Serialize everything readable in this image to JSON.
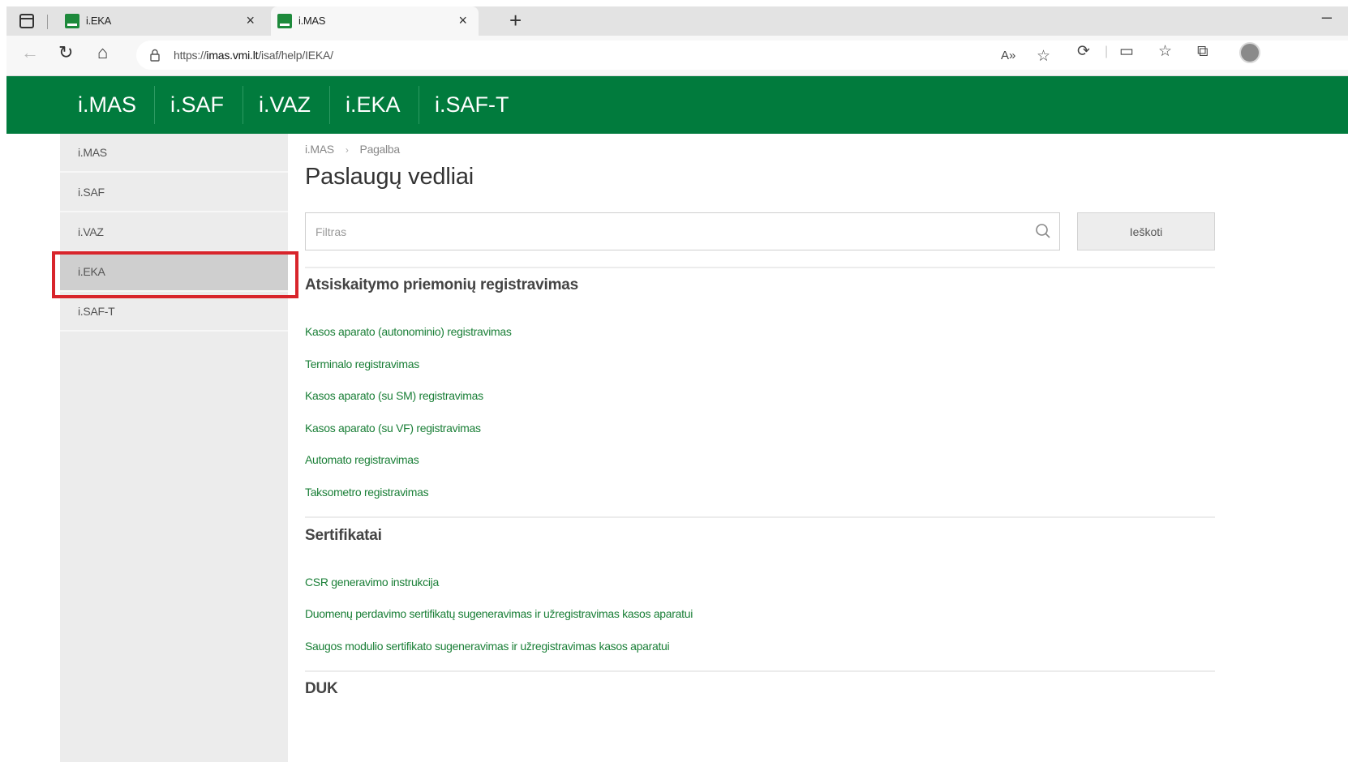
{
  "browser": {
    "tabs": [
      {
        "title": "i.EKA",
        "active": false
      },
      {
        "title": "i.MAS",
        "active": true
      }
    ],
    "new_tab_label": "+",
    "close_glyph": "×",
    "minimize_glyph": "–",
    "url_prefix": "https://",
    "url_host": "imas.vmi.lt",
    "url_path": "/isaf/help/IEKA/",
    "icons": {
      "back": "←",
      "reload": "↻",
      "home": "⌂",
      "lock": "🔒",
      "read_aloud": "A»",
      "add_favorite": "☆",
      "extensions": "⟳",
      "split_screen": "▭",
      "favorites": "☆",
      "collections": "⧉"
    }
  },
  "site_nav": {
    "items": [
      "i.MAS",
      "i.SAF",
      "i.VAZ",
      "i.EKA",
      "i.SAF-T"
    ],
    "brand_color": "#017b3d"
  },
  "sidebar": {
    "items": [
      {
        "label": "i.MAS",
        "active": false
      },
      {
        "label": "i.SAF",
        "active": false
      },
      {
        "label": "i.VAZ",
        "active": false
      },
      {
        "label": "i.EKA",
        "active": true
      },
      {
        "label": "i.SAF-T",
        "active": false
      }
    ],
    "highlight_color": "#d8242b"
  },
  "breadcrumb": {
    "root": "i.MAS",
    "separator": "›",
    "current": "Pagalba"
  },
  "page_title": "Paslaugų vedliai",
  "filter": {
    "placeholder": "Filtras",
    "value": ""
  },
  "search_button_label": "Ieškoti",
  "sections": [
    {
      "title": "Atsiskaitymo priemonių registravimas",
      "links": [
        "Kasos aparato (autonominio) registravimas",
        "Terminalo registravimas",
        "Kasos aparato (su SM) registravimas",
        "Kasos aparato (su VF) registravimas",
        "Automato registravimas",
        "Taksometro registravimas"
      ]
    },
    {
      "title": "Sertifikatai",
      "links": [
        "CSR generavimo instrukcija",
        "Duomenų perdavimo sertifikatų sugeneravimas ir užregistravimas kasos aparatui",
        "Saugos modulio sertifikato sugeneravimas ir užregistravimas kasos aparatui"
      ]
    },
    {
      "title": "DUK",
      "links": []
    }
  ],
  "link_color": "#1a7f37"
}
